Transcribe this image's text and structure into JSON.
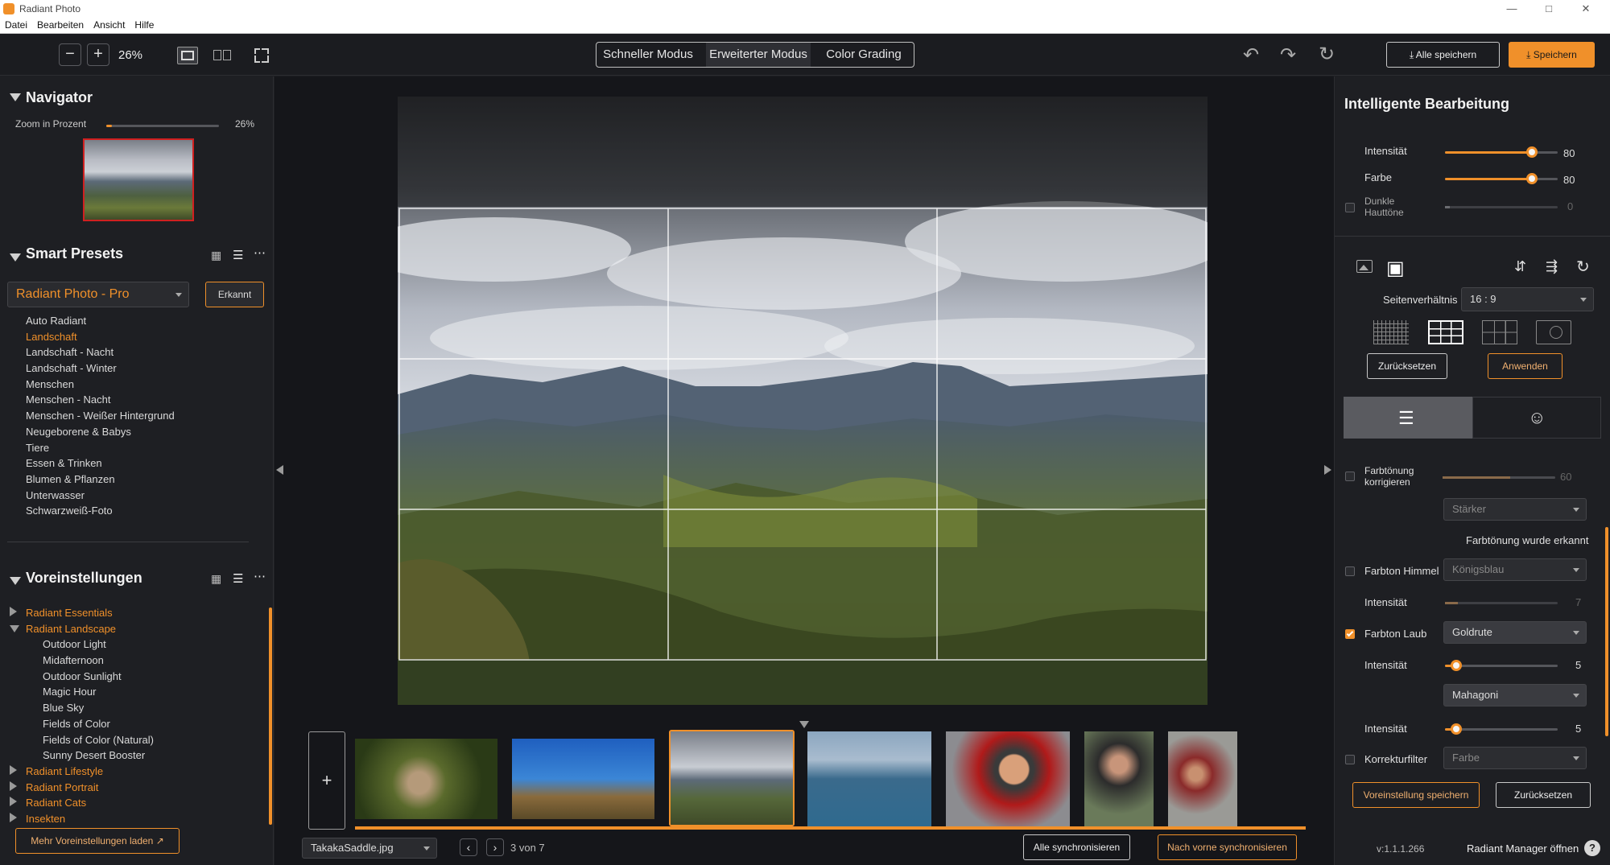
{
  "app": {
    "title": "Radiant Photo",
    "menu": [
      "Datei",
      "Bearbeiten",
      "Ansicht",
      "Hilfe"
    ]
  },
  "toolbar": {
    "zoom_value": "26%",
    "modes": [
      "Schneller Modus",
      "Erweiterter Modus",
      "Color Grading"
    ],
    "active_mode": "Erweiterter Modus",
    "save_all_label": "Alle speichern",
    "save_label": "Speichern"
  },
  "navigator": {
    "title": "Navigator",
    "zoom_label": "Zoom in Prozent",
    "zoom_value": "26%",
    "zoom_fraction": 0.05
  },
  "smart_presets": {
    "title": "Smart Presets",
    "selected": "Radiant Photo - Pro",
    "detected_label": "Erkannt",
    "items": [
      {
        "label": "Auto Radiant",
        "active": false
      },
      {
        "label": "Landschaft",
        "active": true
      },
      {
        "label": "Landschaft - Nacht",
        "active": false
      },
      {
        "label": "Landschaft - Winter",
        "active": false
      },
      {
        "label": "Menschen",
        "active": false
      },
      {
        "label": "Menschen - Nacht",
        "active": false
      },
      {
        "label": "Menschen - Weißer Hintergrund",
        "active": false
      },
      {
        "label": "Neugeborene & Babys",
        "active": false
      },
      {
        "label": "Tiere",
        "active": false
      },
      {
        "label": "Essen & Trinken",
        "active": false
      },
      {
        "label": "Blumen & Pflanzen",
        "active": false
      },
      {
        "label": "Unterwasser",
        "active": false
      },
      {
        "label": "Schwarzweiß-Foto",
        "active": false
      }
    ]
  },
  "presets": {
    "title": "Voreinstellungen",
    "groups": [
      {
        "label": "Radiant Essentials",
        "expanded": false
      },
      {
        "label": "Radiant Landscape",
        "expanded": true,
        "children": [
          "Outdoor Light",
          "Midafternoon",
          "Outdoor Sunlight",
          "Magic Hour",
          "Blue Sky",
          "Fields of Color",
          "Fields of Color (Natural)",
          "Sunny Desert Booster"
        ]
      },
      {
        "label": "Radiant Lifestyle",
        "expanded": false
      },
      {
        "label": "Radiant Portrait",
        "expanded": false
      },
      {
        "label": "Radiant Cats",
        "expanded": false
      },
      {
        "label": "Insekten",
        "expanded": false
      }
    ],
    "more_label": "Mehr Voreinstellungen laden"
  },
  "filmstrip": {
    "filename": "TakakaSaddle.jpg",
    "counter": "3 von 7",
    "sync_all_label": "Alle synchronisieren",
    "sync_forward_label": "Nach vorne synchronisieren",
    "add_label": "+"
  },
  "smart_edit": {
    "title": "Intelligente Bearbeitung",
    "intensity_label": "Intensität",
    "intensity_value": "80",
    "color_label": "Farbe",
    "color_value": "80",
    "dark_skin_label_1": "Dunkle",
    "dark_skin_label_2": "Hauttöne",
    "dark_skin_value": "0"
  },
  "crop": {
    "aspect_label": "Seitenverhältnis",
    "aspect_value": "16 : 9",
    "reset_label": "Zurücksetzen",
    "apply_label": "Anwenden"
  },
  "adjustments": {
    "tint_label_1": "Farbtönung",
    "tint_label_2": "korrigieren",
    "tint_value": "60",
    "tint_strength": "Stärker",
    "tint_detected": "Farbtönung wurde erkannt",
    "sky_label": "Farbton Himmel",
    "sky_value": "Königsblau",
    "sky_intensity_label": "Intensität",
    "sky_intensity_value": "7",
    "foliage_label": "Farbton Laub",
    "foliage_value": "Goldrute",
    "foliage_intensity_label": "Intensität",
    "foliage_intensity_value": "5",
    "second_color": "Mahagoni",
    "second_intensity_label": "Intensität",
    "second_intensity_value": "5",
    "filter_label": "Korrekturfilter",
    "filter_value": "Farbe"
  },
  "footer": {
    "save_preset_label": "Voreinstellung speichern",
    "reset_label": "Zurücksetzen",
    "version": "v:1.1.1.266",
    "manager_label": "Radiant Manager öffnen"
  },
  "colors": {
    "accent": "#f0902a",
    "panel": "#1e1f23",
    "canvas": "#15161a"
  }
}
